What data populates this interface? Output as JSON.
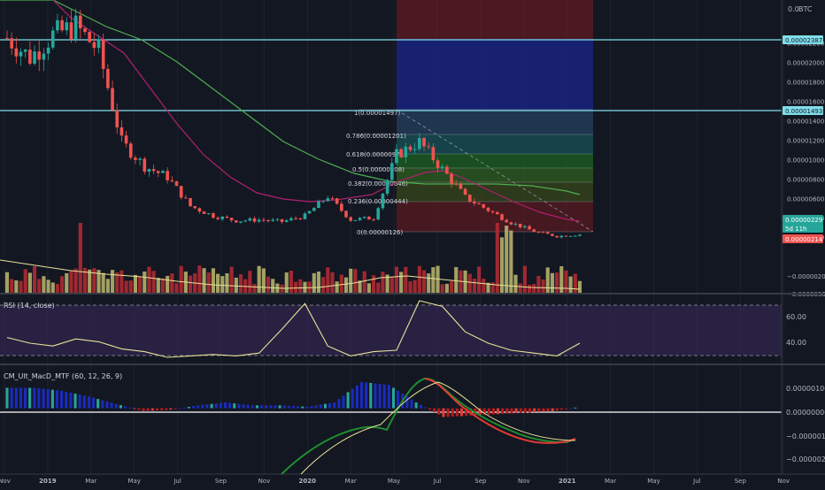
{
  "header": {
    "currency": "BTC",
    "axis_mode": "0.0"
  },
  "price_scale": {
    "ticks": [
      "0.00002200",
      "0.00002000",
      "0.00001800",
      "0.00001600",
      "0.00001400",
      "0.00001200",
      "0.00001000",
      "0.00000800",
      "0.00000600",
      "0.00000400",
      "0.00000200",
      "−0.00000200",
      "−0.00000380"
    ],
    "badges": [
      {
        "label": "0.00002387",
        "color": "#80deea",
        "text_color": "#131722"
      },
      {
        "label": "0.00001493",
        "color": "#80deea",
        "text_color": "#131722"
      },
      {
        "label": "0.00000229",
        "color": "#26a69a",
        "text_color": "#ffffff"
      },
      {
        "label": "5d 11h",
        "color": "#26a69a",
        "text_color": "#ffffff"
      },
      {
        "label": "0.00000214",
        "color": "#ef5350",
        "text_color": "#ffffff"
      }
    ]
  },
  "time_axis": [
    "Nov",
    "2019",
    "Mar",
    "May",
    "Jul",
    "Sep",
    "Nov",
    "2020",
    "Mar",
    "May",
    "Jul",
    "Sep",
    "Nov",
    "2021",
    "Mar",
    "May",
    "Jul",
    "Sep",
    "Nov"
  ],
  "fib_labels": [
    "1(0.00001497)",
    "0.786(0.00001201)",
    "0.618(0.00000971)",
    "0.5(0.00000808)",
    "0.382(0.00000646)",
    "0.236(0.00000444)",
    "0(0.00000126)"
  ],
  "rsi": {
    "title": "RSI (14, close)",
    "ticks": [
      "60.00",
      "40.00"
    ]
  },
  "macd": {
    "title": "CM_Ult_MacD_MTF (60, 12, 26, 9)",
    "ticks": [
      "0.00000100",
      "0.00000000",
      "−0.00000100",
      "−0.00000200"
    ]
  },
  "colors": {
    "up": "#26a69a",
    "down": "#ef5350",
    "ma_green": "#4caf50",
    "ma_purple": "#9c27b0",
    "rsi_line": "#e8e396",
    "signal": "#e8e396",
    "level_line": "#80deea",
    "vol_up": "#b5b06a",
    "vol_down": "#b02a32"
  },
  "chart_data": [
    {
      "type": "candlestick",
      "panel": "price",
      "ylim": [
        -3.8e-06,
        2.64e-05
      ],
      "levels": [
        2.387e-05,
        1.493e-05
      ],
      "ohlc_anchors": [
        {
          "x": "2018-11",
          "y": 2.25e-05
        },
        {
          "x": "2019-01",
          "y": 2.05e-05
        },
        {
          "x": "2019-02",
          "y": 2.28e-05
        },
        {
          "x": "2019-03",
          "y": 2.37e-05
        },
        {
          "x": "2019-04",
          "y": 2.12e-05
        },
        {
          "x": "2019-05",
          "y": 1.18e-05
        },
        {
          "x": "2019-06",
          "y": 9.3e-06
        },
        {
          "x": "2019-07",
          "y": 8.2e-06
        },
        {
          "x": "2019-08",
          "y": 5.2e-06
        },
        {
          "x": "2019-09",
          "y": 4.2e-06
        },
        {
          "x": "2019-10",
          "y": 3.7e-06
        },
        {
          "x": "2019-11",
          "y": 3.8e-06
        },
        {
          "x": "2019-12",
          "y": 3.6e-06
        },
        {
          "x": "2020-01",
          "y": 4.2e-06
        },
        {
          "x": "2020-02",
          "y": 6.2e-06
        },
        {
          "x": "2020-03",
          "y": 3.8e-06
        },
        {
          "x": "2020-04",
          "y": 4e-06
        },
        {
          "x": "2020-05",
          "y": 1.05e-05
        },
        {
          "x": "2020-06",
          "y": 1.18e-05
        },
        {
          "x": "2020-07",
          "y": 9e-06
        },
        {
          "x": "2020-08",
          "y": 6.1e-06
        },
        {
          "x": "2020-09",
          "y": 4.8e-06
        },
        {
          "x": "2020-10",
          "y": 3.5e-06
        },
        {
          "x": "2020-11",
          "y": 2.6e-06
        },
        {
          "x": "2020-12",
          "y": 2.1e-06
        },
        {
          "x": "2021-01",
          "y": 2.3e-06
        }
      ]
    },
    {
      "type": "line",
      "panel": "rsi",
      "ylim": [
        25,
        75
      ],
      "series": [
        {
          "values": [
            44,
            40,
            38,
            43,
            41,
            36,
            34,
            30,
            31,
            32,
            31,
            33,
            50,
            68,
            38,
            31,
            34,
            35,
            70,
            66,
            48,
            40,
            35,
            33,
            31,
            40
          ]
        }
      ]
    },
    {
      "type": "bar",
      "panel": "macd",
      "ylim": [
        -2.25e-06,
        1.5e-06
      ],
      "series": [
        {
          "values": [
            7e-07,
            7e-07,
            6e-07,
            4e-07,
            1.5e-07,
            -1e-07,
            -5e-08,
            1e-07,
            2e-07,
            1e-07,
            1e-07,
            5e-08,
            2e-07,
            9e-07,
            8e-07,
            2e-07,
            -3e-07,
            -2.5e-07,
            -2e-07,
            -1.5e-07,
            -1e-07,
            5e-08
          ]
        }
      ]
    }
  ]
}
